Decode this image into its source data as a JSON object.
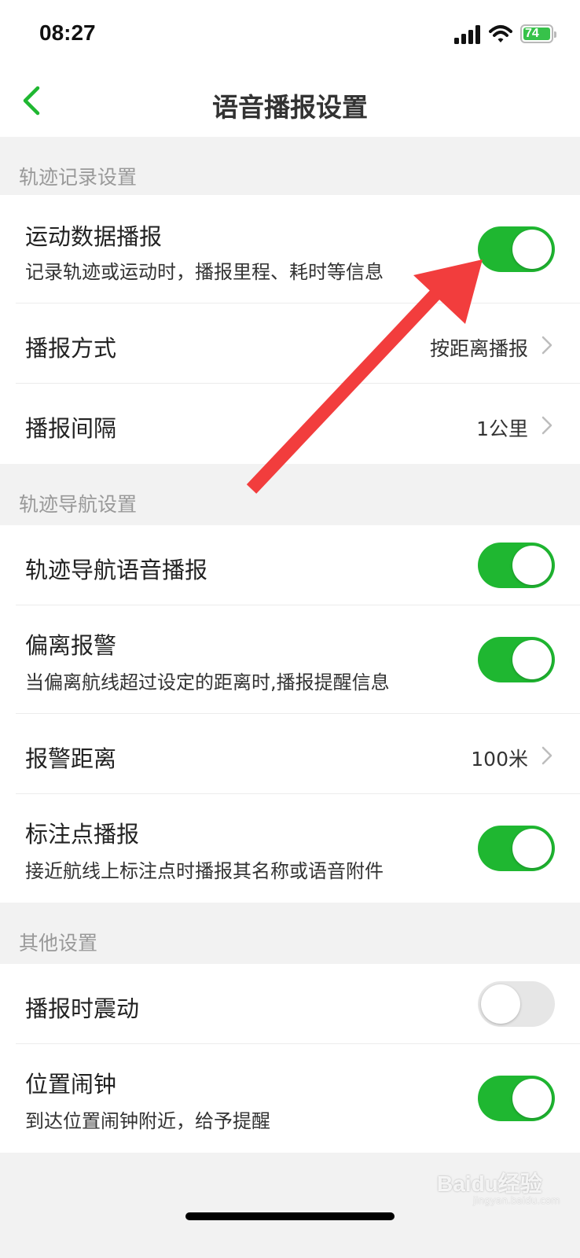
{
  "status_bar": {
    "time": "08:27",
    "battery_level": "74"
  },
  "nav": {
    "title": "语音播报设置"
  },
  "sections": [
    {
      "header": "轨迹记录设置",
      "rows": [
        {
          "title": "运动数据播报",
          "subtitle": "记录轨迹或运动时，播报里程、耗时等信息",
          "toggle": true
        },
        {
          "title": "播报方式",
          "value": "按距离播报"
        },
        {
          "title": "播报间隔",
          "value": "1公里"
        }
      ]
    },
    {
      "header": "轨迹导航设置",
      "rows": [
        {
          "title": "轨迹导航语音播报",
          "toggle": true
        },
        {
          "title": "偏离报警",
          "subtitle": "当偏离航线超过设定的距离时,播报提醒信息",
          "toggle": true
        },
        {
          "title": "报警距离",
          "value": "100米"
        },
        {
          "title": "标注点播报",
          "subtitle": "接近航线上标注点时播报其名称或语音附件",
          "toggle": true
        }
      ]
    },
    {
      "header": "其他设置",
      "rows": [
        {
          "title": "播报时震动",
          "toggle": false
        },
        {
          "title": "位置闹钟",
          "subtitle": "到达位置闹钟附近，给予提醒",
          "toggle": true
        }
      ]
    }
  ],
  "watermark": {
    "text": "Baidu经验",
    "sub": "jingyan.baidu.com"
  },
  "colors": {
    "accent": "#1fb731",
    "annotation_arrow": "#f23d3d"
  }
}
